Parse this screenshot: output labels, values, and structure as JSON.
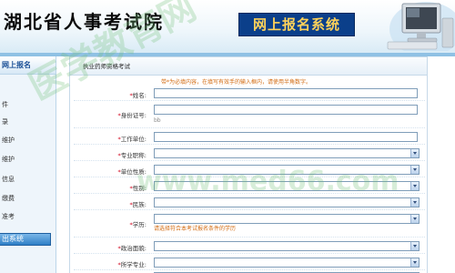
{
  "header": {
    "site_title": "湖北省人事考试院",
    "system_banner": "网上报名系统"
  },
  "sidebar": {
    "heading": "网上报名",
    "items": [
      {
        "label": "件"
      },
      {
        "label": "录"
      },
      {
        "label": "维护"
      },
      {
        "label": "维护"
      },
      {
        "label": "信息"
      },
      {
        "label": "缴费"
      },
      {
        "label": "准考"
      }
    ],
    "bottom_button": "出系统"
  },
  "main": {
    "panel_title": "执业药师资格考试",
    "note": "带*为必填内容，在填写有效手的输入框内，请使用半角数字。",
    "id_hint": "bb",
    "education_hint": "请选择符合本考试报名条件的学历",
    "fields": [
      {
        "label": "*姓名:",
        "type": "text"
      },
      {
        "label": "*身份证号:",
        "type": "text"
      },
      {
        "label": "*工作单位:",
        "type": "text"
      },
      {
        "label": "*专业职称:",
        "type": "select"
      },
      {
        "label": "*单位性质:",
        "type": "select"
      },
      {
        "label": "*性别:",
        "type": "select"
      },
      {
        "label": "*民族:",
        "type": "select"
      },
      {
        "label": "*学历:",
        "type": "select"
      },
      {
        "label": "*政治面貌:",
        "type": "select"
      },
      {
        "label": "*所学专业:",
        "type": "select"
      },
      {
        "label": "*"
      }
    ]
  },
  "watermark": {
    "text_cn": "医学教育网",
    "text_url": "www.med66.com"
  },
  "colors": {
    "accent": "#1a4f96",
    "required": "#d0021b",
    "note": "#d26a10",
    "banner": "#0b3f8a",
    "banner_text": "#ffd25a"
  }
}
